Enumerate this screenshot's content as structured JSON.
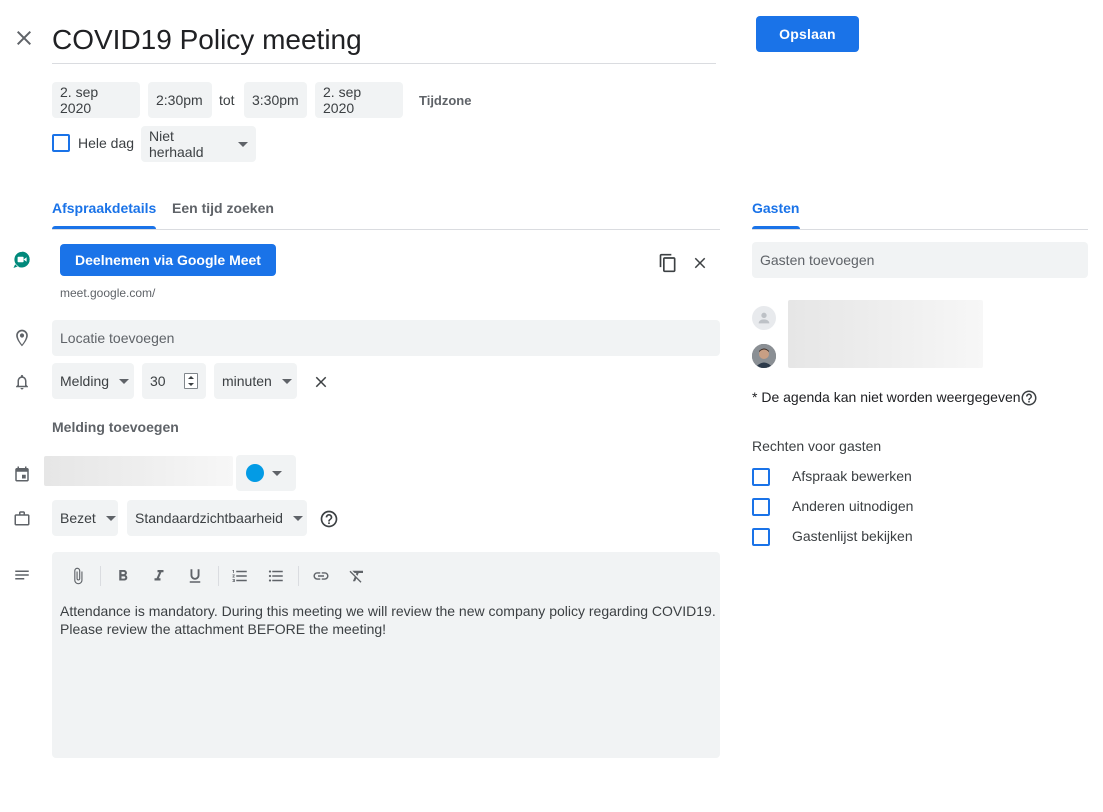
{
  "header": {
    "title": "COVID19 Policy meeting",
    "save_label": "Opslaan"
  },
  "datetime": {
    "start_date": "2. sep 2020",
    "start_time": "2:30pm",
    "separator": "tot",
    "end_time": "3:30pm",
    "end_date": "2. sep 2020",
    "timezone_label": "Tijdzone",
    "all_day_label": "Hele dag",
    "all_day_checked": false,
    "repeat_value": "Niet herhaald"
  },
  "tabs": [
    {
      "label": "Afspraakdetails",
      "active": true
    },
    {
      "label": "Een tijd zoeken",
      "active": false
    }
  ],
  "meet": {
    "button_label": "Deelnemen via Google Meet",
    "url": "meet.google.com/"
  },
  "location": {
    "placeholder": "Locatie toevoegen"
  },
  "notification": {
    "type": "Melding",
    "amount": "30",
    "unit": "minuten",
    "add_label": "Melding toevoegen"
  },
  "calendar": {
    "color": "#039be5"
  },
  "availability": {
    "status": "Bezet",
    "visibility": "Standaardzichtbaarheid"
  },
  "description": {
    "text": "Attendance is mandatory. During this meeting we will review the new company policy regarding COVID19.\nPlease review the attachment BEFORE the meeting!"
  },
  "guests": {
    "tab_label": "Gasten",
    "add_placeholder": "Gasten toevoegen",
    "agenda_note": "* De agenda kan niet worden weergegeven",
    "permissions_title": "Rechten voor gasten",
    "permissions": [
      {
        "label": "Afspraak bewerken",
        "checked": false
      },
      {
        "label": "Anderen uitnodigen",
        "checked": false
      },
      {
        "label": "Gastenlijst bekijken",
        "checked": false
      }
    ]
  },
  "colors": {
    "accent": "#1a73e8",
    "meet_green": "#00897b",
    "text": "#3c4043",
    "field_bg": "#f1f3f4"
  }
}
